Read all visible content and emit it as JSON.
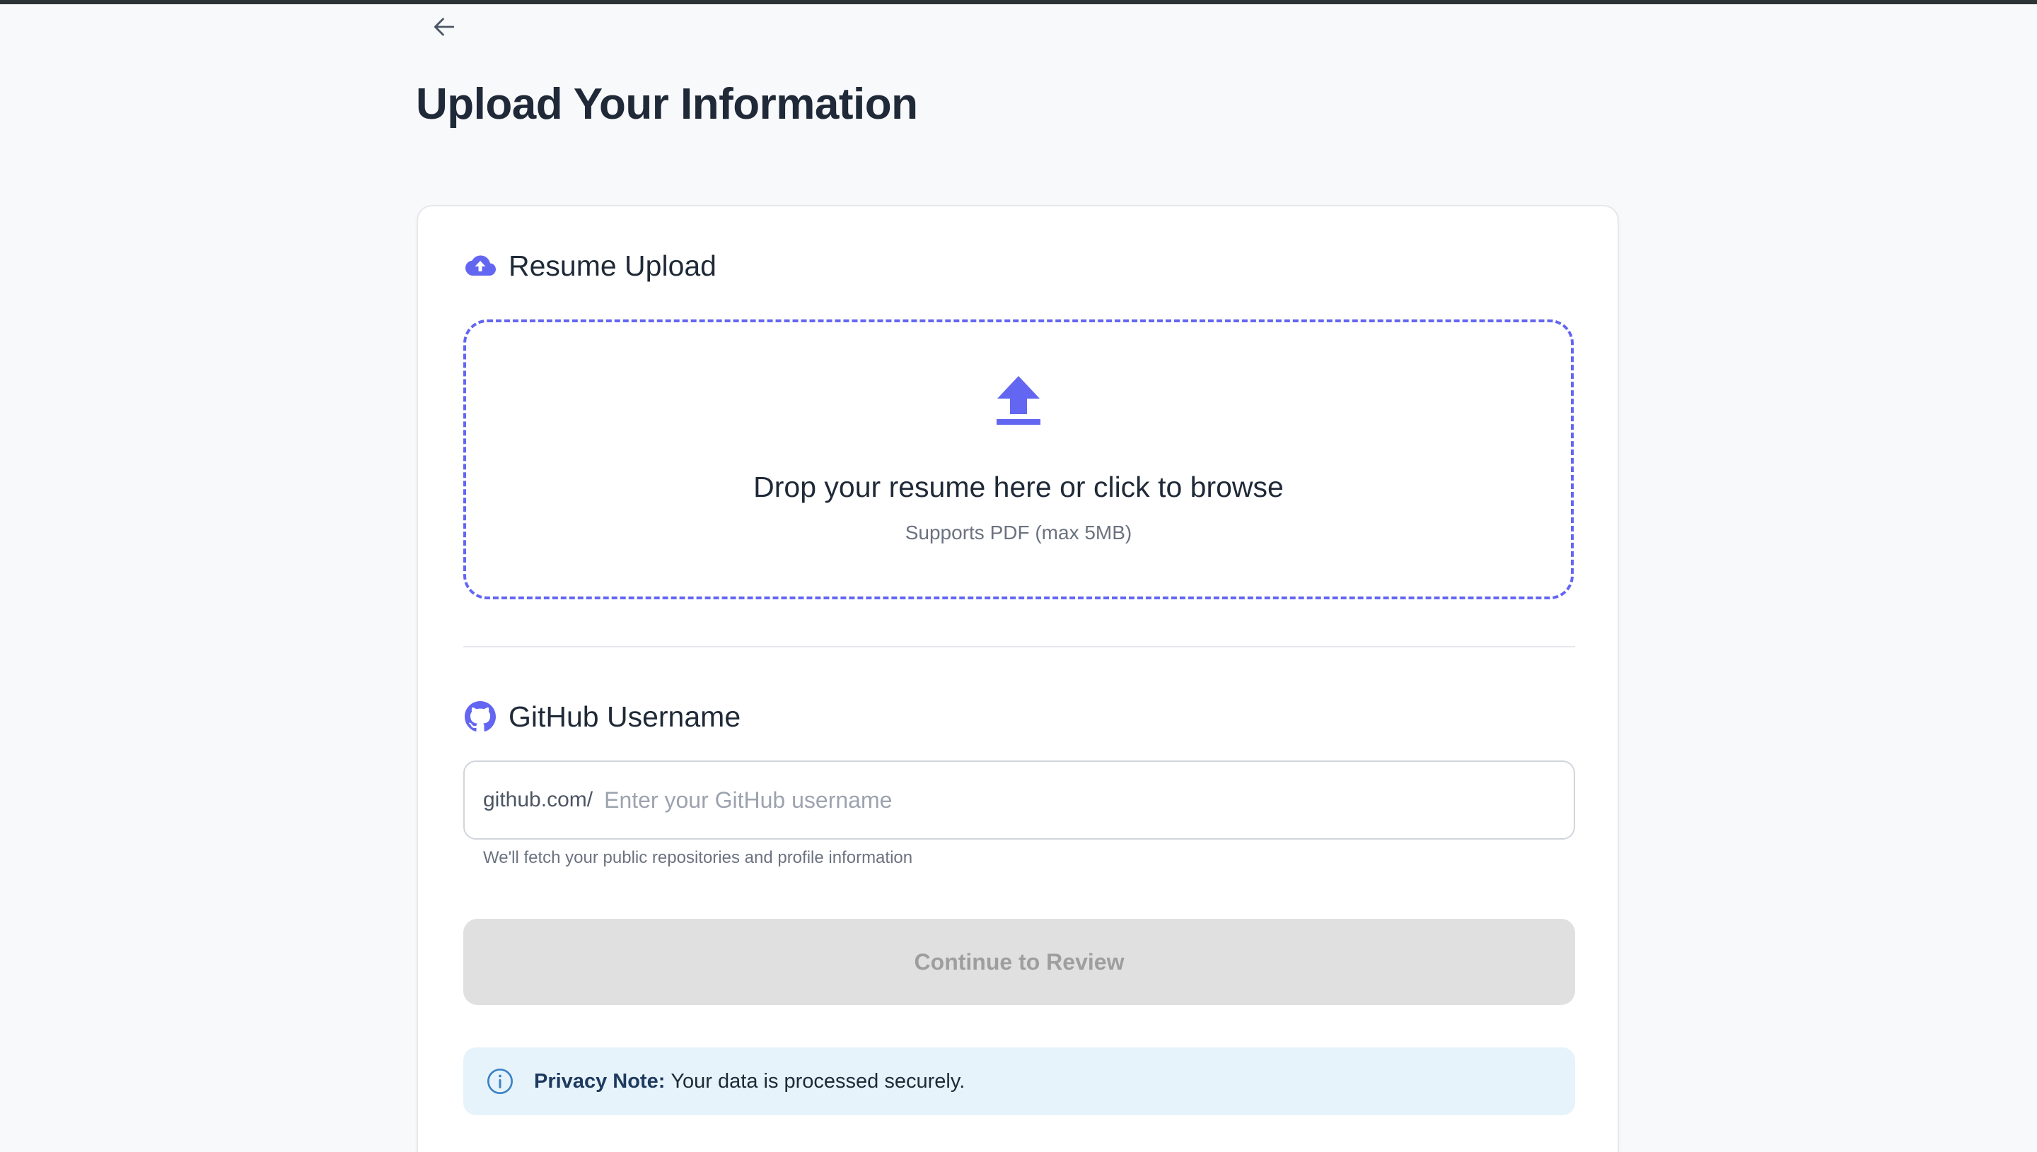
{
  "page": {
    "title": "Upload Your Information"
  },
  "resume": {
    "heading": "Resume Upload",
    "drop_title": "Drop your resume here or click to browse",
    "drop_subtitle": "Supports PDF (max 5MB)"
  },
  "github": {
    "heading": "GitHub Username",
    "prefix": "github.com/",
    "placeholder": "Enter your GitHub username",
    "value": "",
    "helper": "We'll fetch your public repositories and profile information"
  },
  "actions": {
    "continue_label": "Continue to Review"
  },
  "privacy": {
    "label": "Privacy Note:",
    "text": "Your data is processed securely."
  },
  "icons": {
    "back": "arrow-left-icon",
    "resume_section": "cloud-upload-icon",
    "dropzone": "upload-arrow-icon",
    "github_section": "github-icon",
    "privacy": "info-icon"
  },
  "colors": {
    "accent": "#6366f1",
    "background": "#f8f9fb",
    "card": "#ffffff",
    "disabled_button_bg": "#e0e0e0",
    "disabled_button_text": "#9e9e9e",
    "privacy_bg": "#e6f3fb",
    "info_icon": "#3b82c4"
  }
}
